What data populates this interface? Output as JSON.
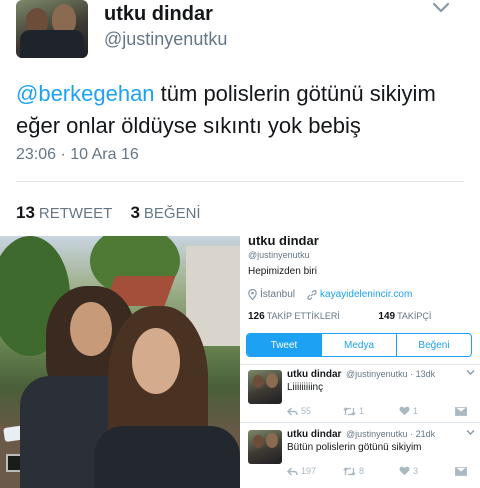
{
  "tweet": {
    "display_name": "utku dindar",
    "handle": "@justinyenutku",
    "mention": "@berkegehan",
    "text_line1_rest": " tüm polislerin götünü sikiyim",
    "text_line2": "eğer onlar öldüyse sıkıntı yok bebiş",
    "timestamp": "23:06 · 10 Ara 16",
    "retweet_count": "13",
    "retweet_label": "RETWEET",
    "like_count": "3",
    "like_label": "BEĞENİ"
  },
  "profile": {
    "name": "utku dindar",
    "handle": "@justinyenutku",
    "bio": "Hepimizden biri",
    "location": "İstanbul",
    "website": "kayayidelenincir.com",
    "following_count": "126",
    "following_label": "TAKİP ETTİKLERİ",
    "followers_count": "149",
    "followers_label": "TAKİPÇİ",
    "tabs": [
      "Tweet",
      "Medya",
      "Beğeni"
    ]
  },
  "mini_tweets": [
    {
      "name": "utku dindar",
      "handle_time": "@justinyenutku · 13dk",
      "text": "Liiiiiiiiinç",
      "replies": "",
      "retweets": "55",
      "rt2": "1",
      "likes": "1"
    },
    {
      "name": "utku dindar",
      "handle_time": "@justinyenutku · 21dk",
      "text": "Bütün polislerin götünü sikiyim",
      "replies": "",
      "retweets": "197",
      "rt2": "8",
      "likes": "3"
    }
  ],
  "colors": {
    "accent": "#1da1f2",
    "muted": "#657786",
    "text": "#14171a"
  },
  "icons": [
    "chevron-down-icon",
    "location-pin-icon",
    "link-icon",
    "reply-icon",
    "retweet-icon",
    "heart-icon",
    "message-icon"
  ]
}
